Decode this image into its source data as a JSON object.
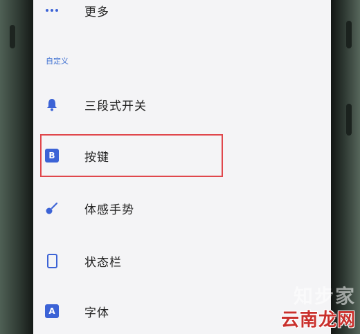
{
  "menu": {
    "more": {
      "label": "更多",
      "icon": "more-dots-icon"
    },
    "section_title": "自定义",
    "items": [
      {
        "label": "三段式开关",
        "icon": "bell-icon"
      },
      {
        "label": "按键",
        "icon": "b-square-icon",
        "icon_text": "B"
      },
      {
        "label": "体感手势",
        "icon": "gesture-icon"
      },
      {
        "label": "状态栏",
        "icon": "phone-icon"
      },
      {
        "label": "字体",
        "icon": "a-square-icon",
        "icon_text": "A"
      }
    ]
  },
  "highlight_color": "#e0474c",
  "accent_color": "#3c63d6",
  "watermarks": {
    "top": "知步家",
    "bottom": "云南龙网"
  }
}
